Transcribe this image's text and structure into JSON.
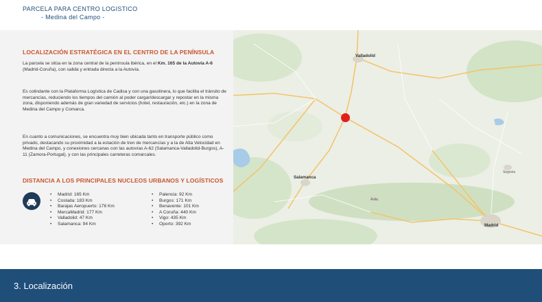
{
  "header": {
    "title": "PARCELA PARA CENTRO LOGISTICO",
    "subtitle": "- Medina del Campo -"
  },
  "section1": {
    "heading": "LOCALIZACIÓN ESTRATÉGICA EN EL CENTRO DE LA PENÍNSULA",
    "p1_a": "La parcela se sitúa en la zona central de la península ibérica, en el ",
    "p1_bold": "Km. 165 de la Autovía A-6",
    "p1_b": " (Madrid-Coruña), con salida y entrada directa a la Autovía.",
    "p2": "Es colindante con la Plataforma Logística de Cadisa y con una gasolinera, lo que facilita el tránsito de mercancías, reduciendo los tiempos del camión al poder cargar/descargar y repostar en la misma zona, disponiendo además de gran variedad de servicios (hotel, restauración, etc.) en la zona de Medina del Campo y Comarca.",
    "p3": "En cuanto a comunicaciones, se encuentra muy bien ubicada tanto en transporte público como privado, destacando su proximidad a la estación de tren de mercancías y a la de Alta Velocidad en Medina del Campo, y conexiones cercanas con las autovías A-62 (Salamanca-Valladolid-Burgos), A-11 (Zamora-Portugal), y con las principales carreteras comarcales."
  },
  "section2": {
    "heading": "DISTANCIA A LOS PRINCIPALES NUCLEOS URBANOS Y LOGÍSTICOS",
    "icon": "car-icon",
    "col1": [
      "Madrid: 165 Km",
      "Coslada: 183 Km",
      "Barajas Aeropuerto: 176 Km",
      "MercaMadrid: 177 Km",
      "Valladolid: 47 Km",
      "Salamanca: 94 Km"
    ],
    "col2": [
      "Palencia: 92 Km",
      "Burgos: 171 Km",
      "Benavente: 101 Km",
      "A Coruña: 440 Km",
      "Vigo: 435 Km",
      "Oporto: 392 Km"
    ]
  },
  "map": {
    "cities": [
      "Valladolid",
      "Salamanca",
      "Madrid",
      "Ávila",
      "Segovia"
    ],
    "marker_color": "#e0201b"
  },
  "footer": {
    "title": "3. Localización"
  },
  "colors": {
    "accent": "#c9542f",
    "brand": "#1f4e79"
  }
}
